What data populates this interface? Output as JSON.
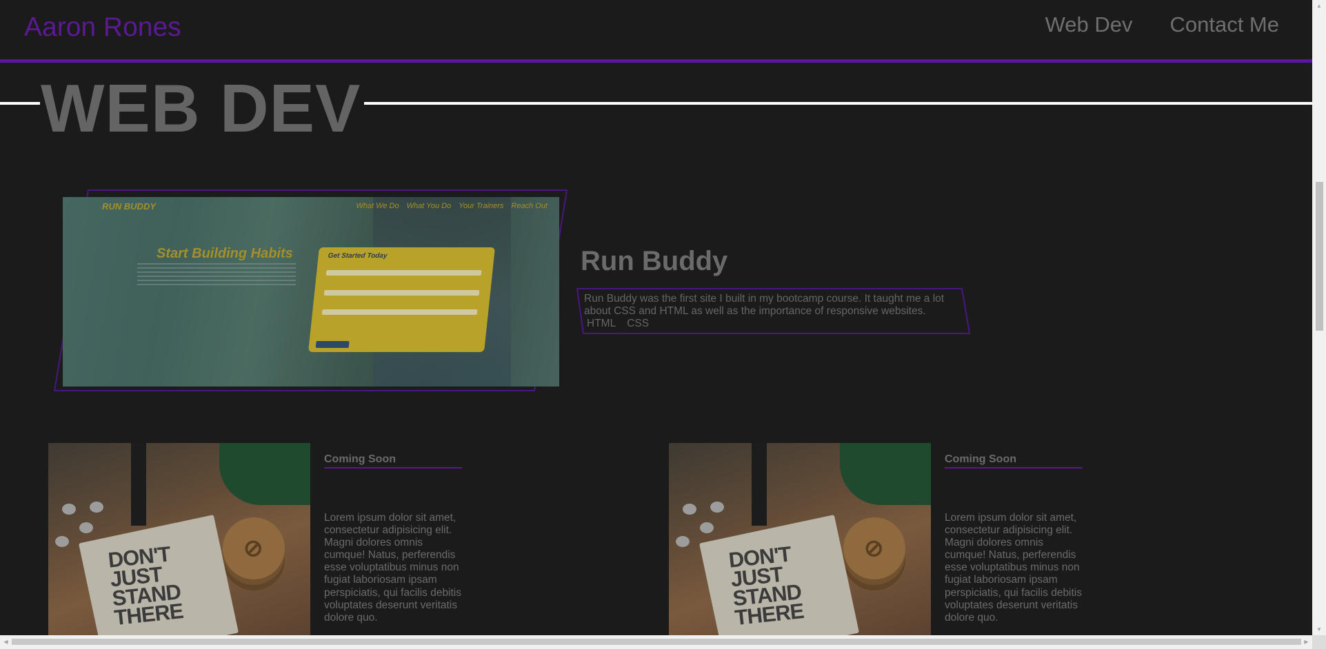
{
  "header": {
    "brand": "Aaron Rones",
    "nav": [
      "Web Dev",
      "Contact Me"
    ],
    "accent_color": "#5b14a4"
  },
  "section": {
    "title": "WEB DEV"
  },
  "featured_project": {
    "screenshot": {
      "brand": "RUN BUDDY",
      "nav": [
        "What We Do",
        "What You Do",
        "Your Trainers",
        "Reach Out"
      ],
      "hero": "Start Building Habits",
      "form_title": "Get Started Today"
    },
    "title": "Run Buddy",
    "description": "Run Buddy was the first site I built in my bootcamp course. It taught me a lot about CSS and HTML as well as the importance of responsive websites.",
    "tags": [
      "HTML",
      "CSS"
    ]
  },
  "cards": [
    {
      "title": "Coming Soon",
      "image_text": "DON'T JUST STAND THERE",
      "body": "Lorem ipsum dolor sit amet, consectetur adipisicing elit. Magni dolores omnis cumque! Natus, perferendis esse voluptatibus minus non fugiat laboriosam ipsam perspiciatis, qui facilis debitis voluptates deserunt veritatis dolore quo."
    },
    {
      "title": "Coming Soon",
      "image_text": "DON'T JUST STAND THERE",
      "body": "Lorem ipsum dolor sit amet, consectetur adipisicing elit. Magni dolores omnis cumque! Natus, perferendis esse voluptatibus minus non fugiat laboriosam ipsam perspiciatis, qui facilis debitis voluptates deserunt veritatis dolore quo."
    }
  ],
  "scrollbars": {
    "arrow_up": "▲",
    "arrow_down": "▼",
    "arrow_left": "◀",
    "arrow_right": "▶"
  }
}
